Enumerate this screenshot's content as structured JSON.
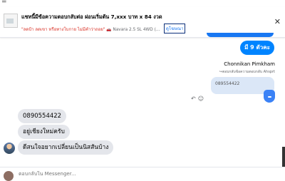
{
  "header": {
    "menu_icon": "list-icon",
    "banner_title": "แชทนี้มีข้อความตอบกลับต่อ ผ่อนเริ่มต้น 7,xxx บาท x 84 งวด",
    "banner_red": "\"ลดป้า ลดเขา หรือทางโบกาย ไม่มีคำว่าถอย\"",
    "banner_sub": " 🚗 Navara 2.5 SL 4WD (...",
    "banner_link": "ดูโฆษณา",
    "close_icon": "close-icon"
  },
  "messages": {
    "outgoing_9": "มี 9 ตัวคะ",
    "sender_name": "Chonnikan Pimkham",
    "reply_note": "↪ตอบกลับข้อความตอบกลับ Ahsprt",
    "quoted_text": "089554422",
    "incoming": [
      "0890554422",
      "อยู่เชียงใหม่ครับ",
      "ดีสนใจอยากเปลี่ยนเป็นนิสสันบ้าง"
    ]
  },
  "composer": {
    "placeholder": "ตอบกลับใน Messenger..."
  },
  "colors": {
    "accent": "#0084ff",
    "incoming_bubble": "#e4e6eb",
    "link": "#1877f2"
  }
}
